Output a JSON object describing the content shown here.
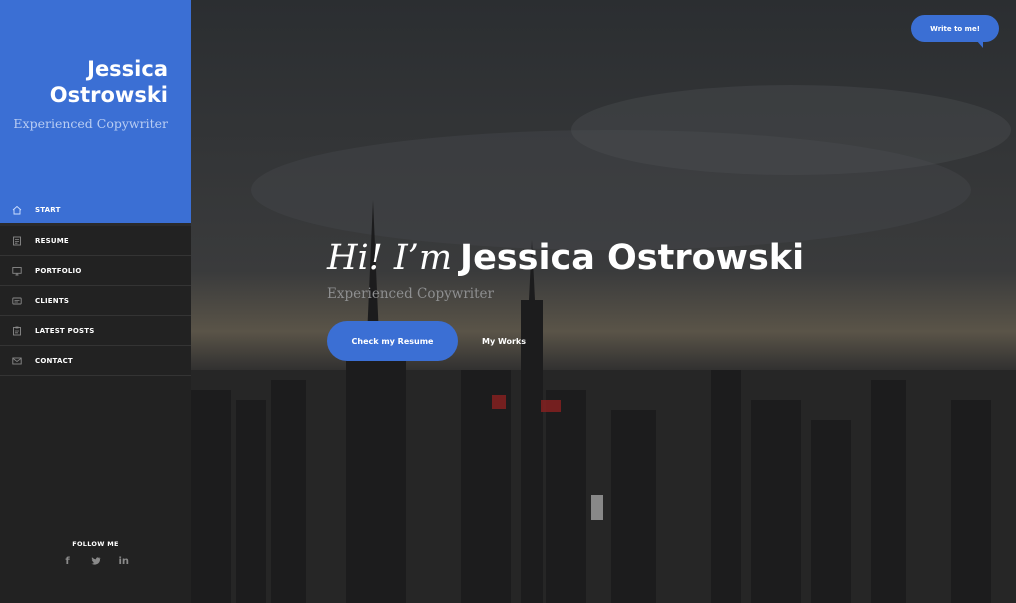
{
  "sidebar": {
    "brand": {
      "name_line1": "Jessica",
      "name_line2": "Ostrowski",
      "subtitle": "Experienced Copywriter"
    },
    "nav": [
      {
        "label": "START",
        "icon": "home-icon",
        "active": true
      },
      {
        "label": "RESUME",
        "icon": "resume-icon",
        "active": false
      },
      {
        "label": "PORTFOLIO",
        "icon": "monitor-icon",
        "active": false
      },
      {
        "label": "CLIENTS",
        "icon": "clients-icon",
        "active": false
      },
      {
        "label": "LATEST POSTS",
        "icon": "posts-icon",
        "active": false
      },
      {
        "label": "CONTACT",
        "icon": "envelope-icon",
        "active": false
      }
    ],
    "follow": {
      "title": "FOLLOW ME",
      "social": [
        {
          "glyph": "f",
          "icon": "facebook-icon"
        },
        {
          "glyph": "t",
          "icon": "twitter-icon"
        },
        {
          "glyph": "in",
          "icon": "linkedin-icon"
        }
      ]
    }
  },
  "hero": {
    "greeting": "Hi! I’m",
    "name": "Jessica Ostrowski",
    "subtitle": "Experienced Copywriter",
    "primary_button": "Check my Resume",
    "secondary_button": "My Works"
  },
  "header": {
    "write_button": "Write to me!"
  },
  "colors": {
    "accent": "#3b6fd4",
    "sidebar_bg": "#222222"
  }
}
